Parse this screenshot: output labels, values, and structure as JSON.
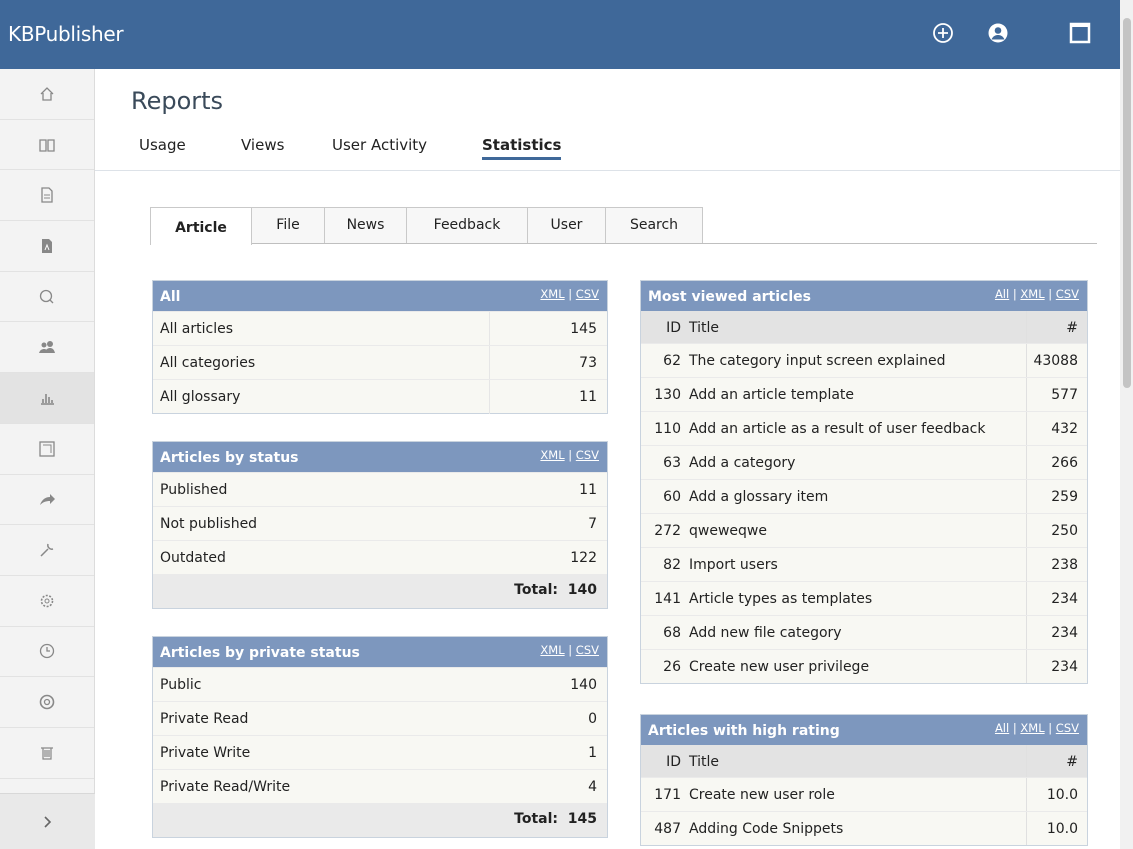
{
  "app": {
    "title": "KBPublisher"
  },
  "topbar": {
    "icons": [
      "add-circle-icon",
      "user-circle-icon",
      "window-icon"
    ]
  },
  "sidebar": {
    "items": [
      "home-icon",
      "book-icon",
      "document-icon",
      "pdf-icon",
      "chat-icon",
      "users-icon",
      "chart-icon",
      "image-icon",
      "share-icon",
      "wrench-icon",
      "gear-icon",
      "clock-icon",
      "lifebuoy-icon",
      "trash-icon"
    ],
    "active": "chart-icon",
    "expand": "chevron-right-icon"
  },
  "page": {
    "title": "Reports",
    "tabs": [
      "Usage",
      "Views",
      "User Activity",
      "Statistics"
    ],
    "active_tab": "Statistics",
    "subtabs": [
      "Article",
      "File",
      "News",
      "Feedback",
      "User",
      "Search"
    ],
    "active_subtab": "Article"
  },
  "boxes": {
    "all": {
      "title": "All",
      "xml": "XML",
      "sep": "|",
      "csv": "CSV",
      "rows": [
        {
          "label": "All articles",
          "value": "145"
        },
        {
          "label": "All categories",
          "value": "73"
        },
        {
          "label": "All glossary",
          "value": "11"
        }
      ]
    },
    "status": {
      "title": "Articles by status",
      "xml": "XML",
      "sep": "|",
      "csv": "CSV",
      "rows": [
        {
          "label": "Published",
          "value": "11"
        },
        {
          "label": "Not published",
          "value": "7"
        },
        {
          "label": "Outdated",
          "value": "122"
        }
      ],
      "total": "Total:  140"
    },
    "private": {
      "title": "Articles by private status",
      "xml": "XML",
      "sep": "|",
      "csv": "CSV",
      "rows": [
        {
          "label": "Public",
          "value": "140"
        },
        {
          "label": "Private Read",
          "value": "0"
        },
        {
          "label": "Private Write",
          "value": "1"
        },
        {
          "label": "Private Read/Write",
          "value": "4"
        }
      ],
      "total": "Total:  145"
    },
    "most_viewed": {
      "title": "Most viewed articles",
      "all": "All",
      "sep": "|",
      "xml": "XML",
      "sep2": "|",
      "csv": "CSV",
      "headers": {
        "id": "ID",
        "title": "Title",
        "num": "#"
      },
      "rows": [
        {
          "id": "62",
          "title": "The category input screen explained",
          "num": "43088"
        },
        {
          "id": "130",
          "title": "Add an article template",
          "num": "577"
        },
        {
          "id": "110",
          "title": "Add an article as a result of user feedback",
          "num": "432"
        },
        {
          "id": "63",
          "title": "Add a category",
          "num": "266"
        },
        {
          "id": "60",
          "title": "Add a glossary item",
          "num": "259"
        },
        {
          "id": "272",
          "title": "qweweqwe",
          "num": "250"
        },
        {
          "id": "82",
          "title": "Import users",
          "num": "238"
        },
        {
          "id": "141",
          "title": "Article types as templates",
          "num": "234"
        },
        {
          "id": "68",
          "title": "Add new file category",
          "num": "234"
        },
        {
          "id": "26",
          "title": "Create new user privilege",
          "num": "234"
        }
      ]
    },
    "high_rating": {
      "title": "Articles with high rating",
      "all": "All",
      "sep": "|",
      "xml": "XML",
      "sep2": "|",
      "csv": "CSV",
      "headers": {
        "id": "ID",
        "title": "Title",
        "num": "#"
      },
      "rows": [
        {
          "id": "171",
          "title": "Create new user role",
          "num": "10.0"
        },
        {
          "id": "487",
          "title": "Adding Code Snippets",
          "num": "10.0"
        }
      ]
    }
  }
}
